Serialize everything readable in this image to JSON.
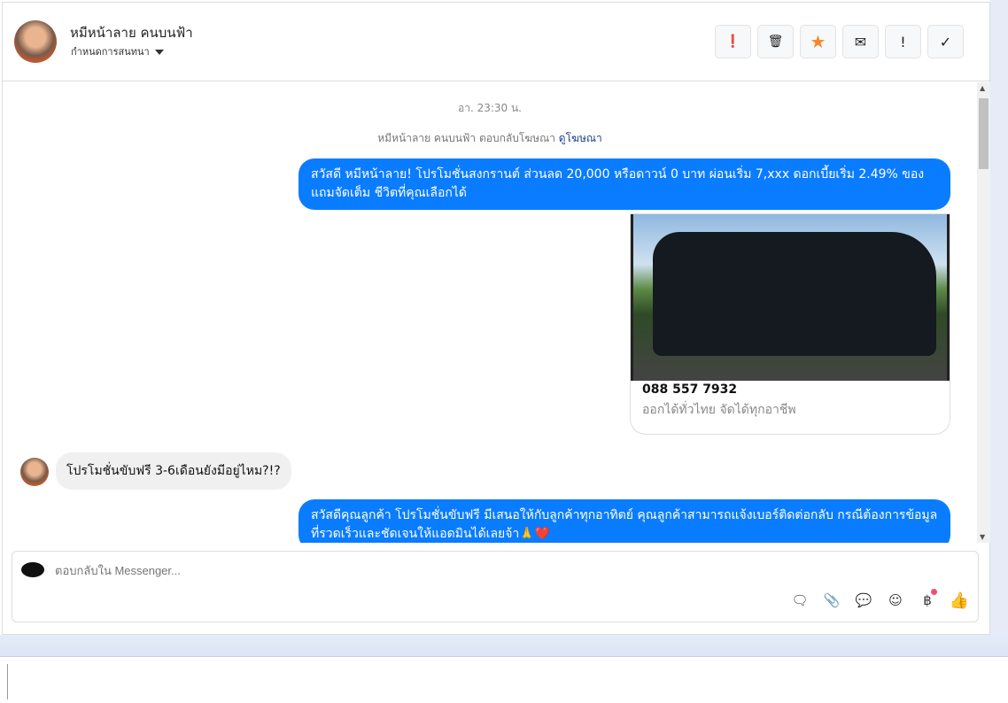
{
  "header": {
    "contact_name": "หมีหน้าลาย คนบนฟ้า",
    "assign_label": "กำหนดการสนทนา",
    "actions": [
      {
        "name": "spam",
        "glyph": "❗"
      },
      {
        "name": "delete",
        "glyph": "🗑"
      },
      {
        "name": "star",
        "glyph": "★"
      },
      {
        "name": "mark-unread",
        "glyph": "✉"
      },
      {
        "name": "follow-up",
        "glyph": "!"
      },
      {
        "name": "done",
        "glyph": "✓"
      }
    ]
  },
  "colors": {
    "accent": "#0a7cff",
    "star": "#f5872a",
    "incoming_bubble": "#f0f0f0"
  },
  "conversation": {
    "timestamp": "อา. 23:30 น.",
    "reply_note": "หมีหน้าลาย คนบนฟ้า ตอบกลับโฆษณา",
    "view_ad_link": "ดูโฆษณา",
    "msg1": "สวัสดี หมีหน้าลาย! โปรโมชั่นสงกรานต์ ส่วนลด 20,000 หรือดาวน์ 0 บาท ผ่อนเริ่ม 7,xxx ดอกเบี้ยเริ่ม 2.49% ของแถมจัดเต็ม ชีวิตที่คุณเลือกได้",
    "card_phone": "088 557 7932",
    "card_desc": "ออกได้ทั่วไทย จัดได้ทุกอาชีพ",
    "msg2": "โปรโมชั่นขับฟรี 3-6เดือนยังมีอยู่ไหม?!?",
    "msg3": "สวัสดีคุณลูกค้า โปรโมชั่นขับฟรี มีเสนอให้กับลูกค้าทุกอาทิตย์ คุณลูกค้าสามารถแจ้งเบอร์ติดต่อกลับ กรณีต้องการข้อมูลที่รวดเร็วและชัดเจนให้แอดมินได้เลยจ้า🙏❤️"
  },
  "composer": {
    "placeholder": "ตอบกลับใน Messenger..."
  }
}
